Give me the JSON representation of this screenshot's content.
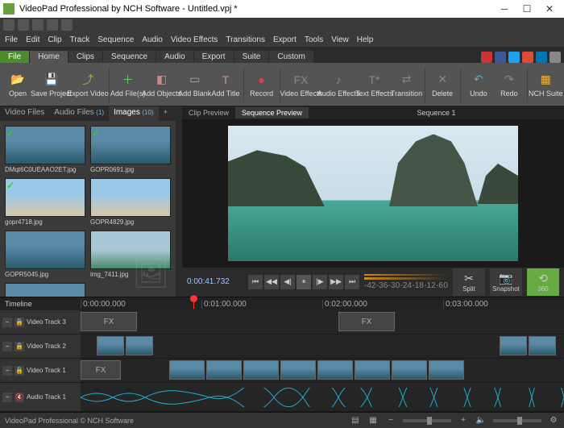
{
  "title": "VideoPad Professional by NCH Software - Untitled.vpj *",
  "menu": [
    "File",
    "Edit",
    "Clip",
    "Track",
    "Sequence",
    "Audio",
    "Video Effects",
    "Transitions",
    "Export",
    "Tools",
    "View",
    "Help"
  ],
  "tabs": {
    "file": "File",
    "items": [
      "Home",
      "Clips",
      "Sequence",
      "Audio",
      "Export",
      "Suite",
      "Custom"
    ]
  },
  "ribbon": {
    "open": "Open",
    "save": "Save Project",
    "export": "Export Video",
    "addfiles": "Add File(s)",
    "addobj": "Add Objects",
    "addblank": "Add Blank",
    "addtitle": "Add Title",
    "record": "Record",
    "vfx": "Video Effects",
    "afx": "Audio Effects",
    "tfx": "Text Effects",
    "trans": "Transition",
    "delete": "Delete",
    "undo": "Undo",
    "redo": "Redo",
    "suite": "NCH Suite"
  },
  "bintabs": {
    "video": "Video Files",
    "audio": "Audio Files",
    "images": "Images",
    "imgcount": "(10)",
    "audiocount": "(1)"
  },
  "thumbs": [
    {
      "name": "DMqt6C0UEAAO2ET.jpg",
      "chk": true
    },
    {
      "name": "GOPR0691.jpg",
      "chk": true
    },
    {
      "name": "gopr4718.jpg",
      "chk": true
    },
    {
      "name": "GOPR4829.jpg",
      "chk": false
    },
    {
      "name": "GOPR5045.jpg",
      "chk": false
    },
    {
      "name": "img_7411.jpg",
      "chk": false
    }
  ],
  "preview": {
    "clip": "Clip Preview",
    "seq": "Sequence Preview",
    "seqname": "Sequence 1",
    "timecode": "0:00:41.732"
  },
  "scrubticks": [
    "-42",
    "-36",
    "-30",
    "-24",
    "-18",
    "-12",
    "-6",
    "0"
  ],
  "sidebtns": {
    "split": "Split",
    "snapshot": "Snapshot",
    "360": "360"
  },
  "timeline": {
    "label": "Timeline",
    "marks": [
      "0:00:00.000",
      "0:01:00.000",
      "0:02:00.000",
      "0:03:00.000"
    ]
  },
  "tracks": {
    "v3": "Video Track 3",
    "v2": "Video Track 2",
    "v1": "Video Track 1",
    "a1": "Audio Track 1"
  },
  "fx": "FX",
  "status": "VideoPad Professional © NCH Software"
}
